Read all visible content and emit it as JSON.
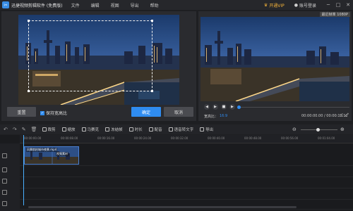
{
  "titlebar": {
    "app_title": "迅捷视频剪辑软件 (免费版)",
    "menu": [
      "文件",
      "编辑",
      "视图",
      "导出",
      "帮助"
    ],
    "vip_label": "开通VIP",
    "login_label": "账号登录"
  },
  "crop": {
    "reset_label": "重置",
    "keep_ratio_label": "保持宽高比",
    "keep_ratio_checked": true,
    "confirm_label": "确定",
    "cancel_label": "取消"
  },
  "preview": {
    "resolution_badge": "最近帧率 1080P",
    "aspect_label": "宽高比：",
    "aspect_value": "16:9",
    "time_display": "00:00:00.00 / 00:00:12.12"
  },
  "toolbar": {
    "tools": [
      "裁剪",
      "缩放",
      "马赛克",
      "冻结帧",
      "时长",
      "配音",
      "语音转文字",
      "导出"
    ]
  },
  "timeline": {
    "ticks": [
      "00:00:00.00",
      "00:00:08.00",
      "00:00:16.00",
      "00:00:24.00",
      "00:00:32.00",
      "00:00:40.00",
      "00:00:48.00",
      "00:00:56.00",
      "00:01:04.00"
    ],
    "clip_label": "风景航拍城市夜景.mp4",
    "clip_label2": "视频素材"
  },
  "colors": {
    "accent": "#2f8cf0",
    "vip": "#f3b23a",
    "playhead": "#4ab0ff"
  }
}
